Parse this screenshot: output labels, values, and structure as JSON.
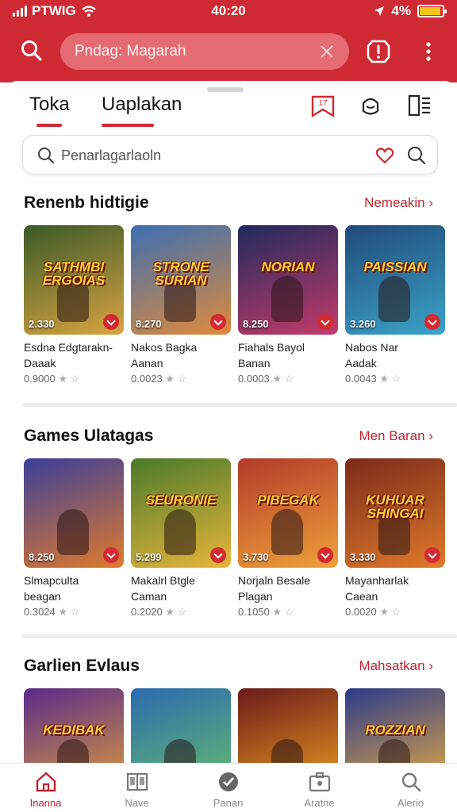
{
  "status": {
    "carrier": "PTWIG",
    "time": "40:20",
    "battery": "4%"
  },
  "header": {
    "search_value": "Pndag: Magarah"
  },
  "tabs": [
    {
      "label": "Toka",
      "active": true
    },
    {
      "label": "Uaplakan",
      "active": true
    }
  ],
  "toolbar": {
    "badge_label": "17"
  },
  "search": {
    "placeholder": "Penarlаgarlaoln"
  },
  "sections": [
    {
      "title": "Renenb hidtigie",
      "link": "Nemeakin",
      "cards": [
        {
          "art_title": "SATHMBI ERGOIAS",
          "price": "2.330",
          "name_1": "Esdna Edgtarakn-",
          "name_2": "Daaak",
          "meta": "0.9000",
          "bg": [
            "#3a5a28",
            "#d9a441"
          ]
        },
        {
          "art_title": "STRONE SURIAN",
          "price": "8.270",
          "name_1": "Nakos Bagka",
          "name_2": "Aanan",
          "meta": "0.0023",
          "bg": [
            "#3b6fb3",
            "#e08a3a"
          ]
        },
        {
          "art_title": "NORIAN",
          "price": "8.250",
          "name_1": "Fiahals Bayol",
          "name_2": "Banan",
          "meta": "0.0003",
          "bg": [
            "#1f2a5c",
            "#c43b6a"
          ]
        },
        {
          "art_title": "PAISSIAN",
          "price": "3.260",
          "name_1": "Nabos Nar",
          "name_2": "Aadak",
          "meta": "0.0043",
          "bg": [
            "#214a7a",
            "#3aa3c9"
          ]
        }
      ]
    },
    {
      "title": "Games Ulatagas",
      "link": "Men Baran",
      "cards": [
        {
          "art_title": "",
          "price": "8.250",
          "name_1": "Slmapculta",
          "name_2": "beagan",
          "meta": "0.3024",
          "bg": [
            "#3a3f9a",
            "#e07a2c"
          ]
        },
        {
          "art_title": "SEURONIE",
          "price": "5.299",
          "name_1": "Makalrl Btgle",
          "name_2": "Caman",
          "meta": "0.2020",
          "bg": [
            "#4a7a2a",
            "#e8b63a"
          ]
        },
        {
          "art_title": "PIBEGAK",
          "price": "3.730",
          "name_1": "Norjaln Besale",
          "name_2": "Plagan",
          "meta": "0.1050",
          "bg": [
            "#b23a2a",
            "#f0a23a"
          ]
        },
        {
          "art_title": "KUHUAR SHINGAI",
          "price": "3.330",
          "name_1": "Mayanharlak",
          "name_2": "Caean",
          "meta": "0.0020",
          "bg": [
            "#7a2a1a",
            "#e07a2a"
          ]
        }
      ]
    },
    {
      "title": "Garlien Evlaus",
      "link": "Mahsatkan",
      "cards": [
        {
          "art_title": "KEDIBAK",
          "price": "",
          "name_1": "",
          "name_2": "",
          "meta": "",
          "bg": [
            "#5a2a8a",
            "#e0a03a"
          ]
        },
        {
          "art_title": "",
          "price": "",
          "name_1": "",
          "name_2": "",
          "meta": "",
          "bg": [
            "#2a6ab0",
            "#6ac06a"
          ]
        },
        {
          "art_title": "",
          "price": "",
          "name_1": "",
          "name_2": "",
          "meta": "",
          "bg": [
            "#6a1a1a",
            "#f0a020"
          ]
        },
        {
          "art_title": "ROZZIAN",
          "price": "",
          "name_1": "",
          "name_2": "",
          "meta": "",
          "bg": [
            "#2a3a8a",
            "#f0b040"
          ]
        }
      ]
    }
  ],
  "nav": [
    {
      "label": "Inanna",
      "icon": "home-icon",
      "active": true
    },
    {
      "label": "Nave",
      "icon": "book-icon",
      "active": false
    },
    {
      "label": "Panan",
      "icon": "badge-icon",
      "active": false
    },
    {
      "label": "Aratne",
      "icon": "camera-icon",
      "active": false
    },
    {
      "label": "Alerio",
      "icon": "search-icon",
      "active": false
    }
  ],
  "colors": {
    "brand": "#cf2a33",
    "accent_link": "#c0252f"
  }
}
